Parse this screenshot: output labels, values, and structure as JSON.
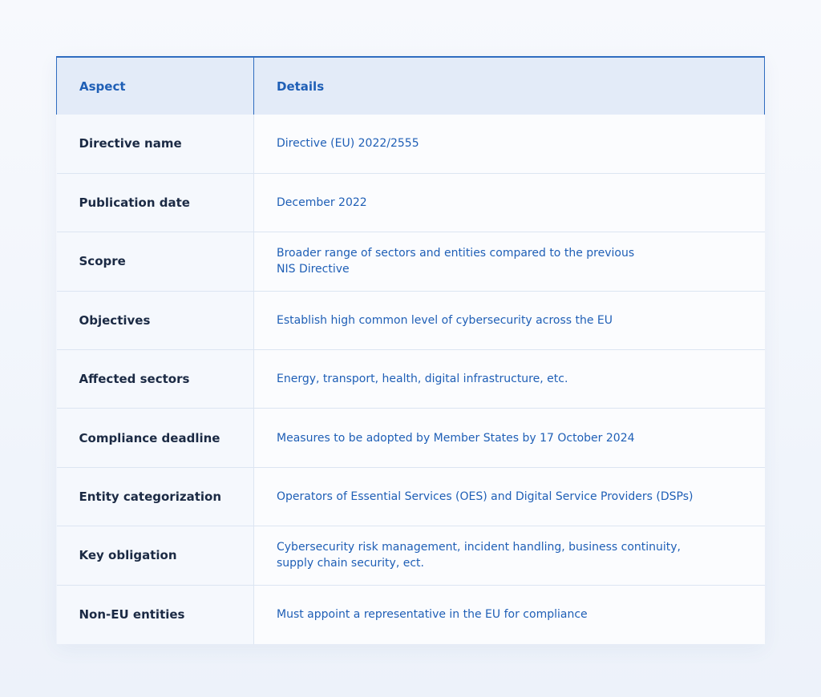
{
  "table": {
    "headers": {
      "aspect": "Aspect",
      "details": "Details"
    },
    "rows": [
      {
        "aspect": "Directive name",
        "details": "Directive (EU) 2022/2555"
      },
      {
        "aspect": "Publication date",
        "details": "December 2022"
      },
      {
        "aspect": "Scopre",
        "details": "Broader range of sectors and entities compared to the previous\nNIS Directive"
      },
      {
        "aspect": "Objectives",
        "details": "Establish high common level of cybersecurity across the EU"
      },
      {
        "aspect": "Affected sectors",
        "details": "Energy, transport, health, digital infrastructure, etc."
      },
      {
        "aspect": "Compliance deadline",
        "details": "Measures to be adopted by Member States by 17 October 2024"
      },
      {
        "aspect": "Entity categorization",
        "details": "Operators of Essential Services (OES) and Digital Service Providers (DSPs)"
      },
      {
        "aspect": "Key obligation",
        "details": "Cybersecurity risk management, incident handling, business continuity,\nsupply chain security, ect."
      },
      {
        "aspect": "Non-EU entities",
        "details": "Must appoint a representative in the EU for compliance"
      }
    ]
  },
  "colors": {
    "header_background": "#e3ebf8",
    "header_text": "#1f5fb6",
    "header_border": "#2f6cc0",
    "aspect_text": "#1b2a44",
    "detail_text": "#1f5fb6",
    "row_divider": "#dce5f2"
  }
}
